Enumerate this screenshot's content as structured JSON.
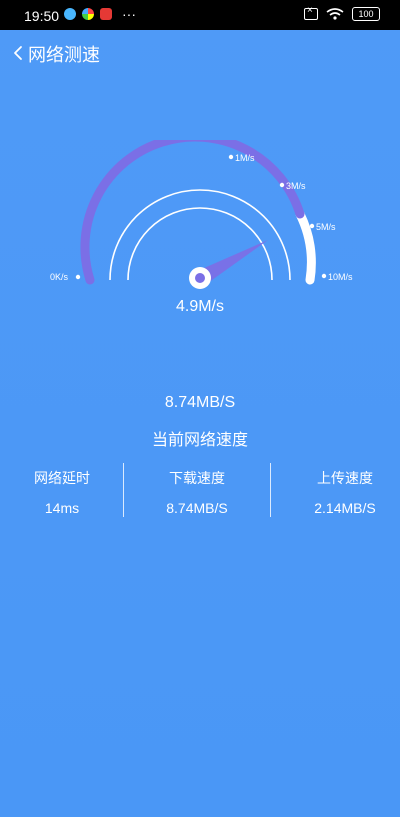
{
  "status_bar": {
    "time": "19:50",
    "battery": "100"
  },
  "header": {
    "title": "网络测速"
  },
  "gauge": {
    "ticks": [
      "0K/s",
      "1M/s",
      "3M/s",
      "5M/s",
      "10M/s"
    ],
    "current_speed": "4.9M/s"
  },
  "summary": {
    "speed": "8.74MB/S",
    "label": "当前网络速度"
  },
  "stats": [
    {
      "label": "网络延时",
      "value": "14ms"
    },
    {
      "label": "下载速度",
      "value": "8.74MB/S"
    },
    {
      "label": "上传速度",
      "value": "2.14MB/S"
    }
  ],
  "colors": {
    "background": "#4a97f6",
    "gauge_purple": "#7b6fe6",
    "gauge_track": "#ffffff"
  }
}
